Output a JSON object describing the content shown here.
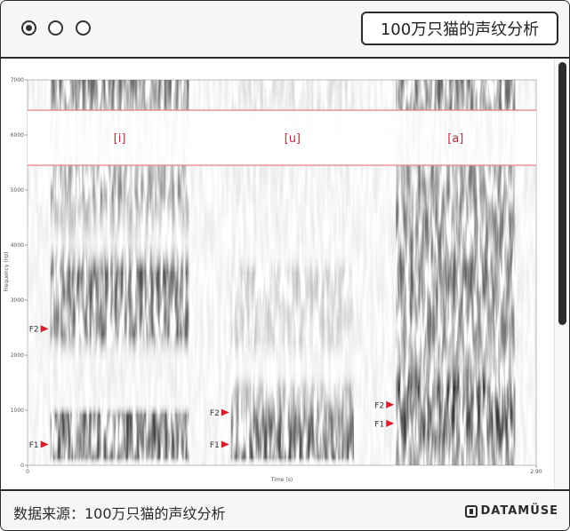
{
  "window": {
    "title": "100万只猫的声纹分析"
  },
  "chart_data": {
    "type": "heatmap",
    "title": "",
    "xlabel": "Time (s)",
    "ylabel": "Frequency (Hz)",
    "xlim": [
      0,
      2.9
    ],
    "ylim": [
      0,
      7000
    ],
    "x_tick_labels": [
      "0",
      "2.90"
    ],
    "y_tick_labels": [
      "0",
      "1000",
      "2000",
      "3000",
      "4000",
      "5000",
      "6000",
      "7000"
    ],
    "vowels": [
      {
        "label": "[i]",
        "start": 0.13,
        "end": 0.92,
        "F1": 380,
        "F2": 2480,
        "F1_label": "F1",
        "F2_label": "F2"
      },
      {
        "label": "[u]",
        "start": 1.16,
        "end": 1.86,
        "F1": 380,
        "F2": 960,
        "F1_label": "F1",
        "F2_label": "F2"
      },
      {
        "label": "[a]",
        "start": 2.1,
        "end": 2.78,
        "F1": 760,
        "F2": 1100,
        "F1_label": "F1",
        "F2_label": "F2"
      }
    ],
    "label_band": [
      5450,
      6450
    ],
    "colors": {
      "marker": "#d81e2c",
      "band_line": "#e9808a"
    }
  },
  "footer": {
    "source_text": "数据来源：100万只猫的声纹分析",
    "brand": "DATAMÜSE"
  }
}
